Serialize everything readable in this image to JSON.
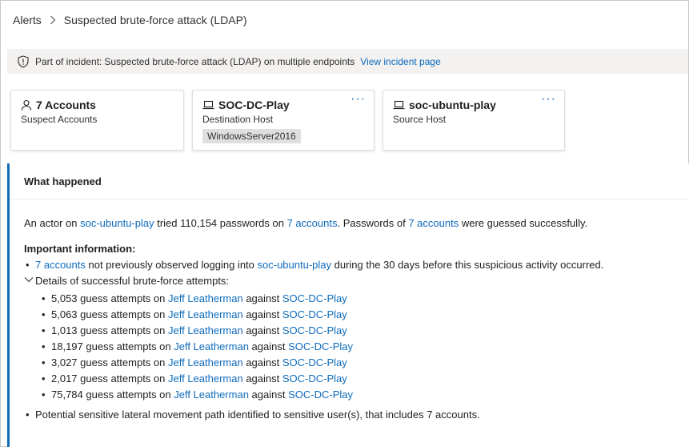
{
  "breadcrumb": {
    "root": "Alerts",
    "current": "Suspected brute-force attack (LDAP)"
  },
  "incident_bar": {
    "label": "Part of incident:",
    "incident_name": "Suspected brute-force attack (LDAP) on multiple endpoints",
    "link": "View incident page"
  },
  "cards": {
    "accounts": {
      "title": "7 Accounts",
      "subtitle": "Suspect Accounts"
    },
    "destination": {
      "title": "SOC-DC-Play",
      "subtitle": "Destination Host",
      "tag": "WindowsServer2016",
      "more": "···"
    },
    "source": {
      "title": "soc-ubuntu-play",
      "subtitle": "Source Host",
      "more": "···"
    }
  },
  "what_happened": {
    "heading": "What happened",
    "summary": {
      "t1": "An actor on ",
      "host": "soc-ubuntu-play",
      "t2": " tried 110,154 passwords on ",
      "accounts1": "7 accounts",
      "t3": ". Passwords of ",
      "accounts2": "7 accounts",
      "t4": " were guessed successfully."
    },
    "important_title": "Important information:",
    "bullet1": {
      "accounts": "7 accounts",
      "t1": " not previously observed logging into ",
      "host": "soc-ubuntu-play",
      "t2": " during the 30 days before this suspicious activity occurred."
    },
    "details_label": "Details of successful brute-force attempts:",
    "attempts": [
      {
        "count": "5,053 guess attempts on ",
        "user": "Jeff Leatherman",
        "mid": " against ",
        "host": "SOC-DC-Play"
      },
      {
        "count": "5,063 guess attempts on ",
        "user": "Jeff Leatherman",
        "mid": " against ",
        "host": "SOC-DC-Play"
      },
      {
        "count": "1,013 guess attempts on ",
        "user": "Jeff Leatherman",
        "mid": " against ",
        "host": "SOC-DC-Play"
      },
      {
        "count": "18,197 guess attempts on ",
        "user": "Jeff Leatherman",
        "mid": " against ",
        "host": "SOC-DC-Play"
      },
      {
        "count": "3,027 guess attempts on ",
        "user": "Jeff Leatherman",
        "mid": " against ",
        "host": "SOC-DC-Play"
      },
      {
        "count": "2,017 guess attempts on ",
        "user": "Jeff Leatherman",
        "mid": " against ",
        "host": "SOC-DC-Play"
      },
      {
        "count": "75,784 guess attempts on ",
        "user": "Jeff Leatherman",
        "mid": " against ",
        "host": "SOC-DC-Play"
      }
    ],
    "last_bullet": "Potential sensitive lateral movement path identified to sensitive user(s), that includes 7 accounts."
  },
  "colors": {
    "accent": "#0f6cbd",
    "panel_border": "#0f6cbd",
    "incident_bg": "#f3f2f1"
  },
  "icons": [
    "chevron-right-icon",
    "shield-icon",
    "person-icon",
    "laptop-icon",
    "chevron-down-icon",
    "more-icon"
  ]
}
